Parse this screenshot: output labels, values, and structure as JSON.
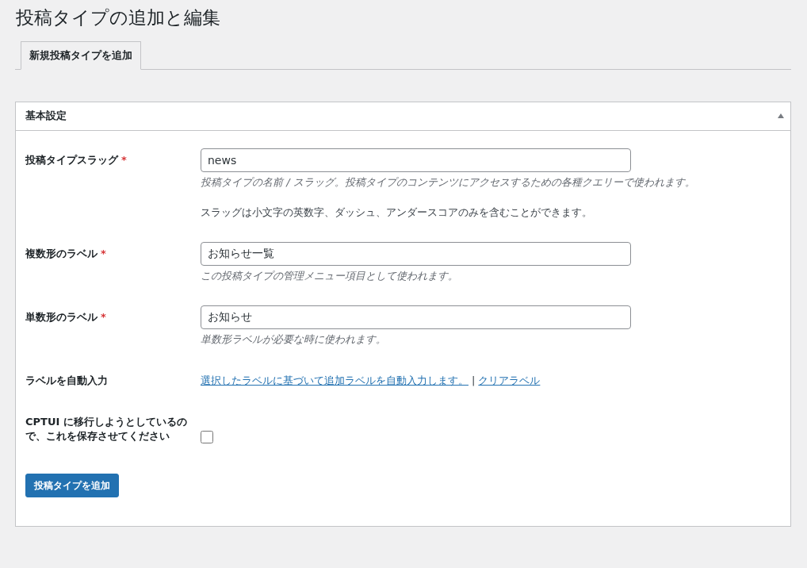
{
  "page_title": "投稿タイプの追加と編集",
  "tabs": [
    {
      "label": "新規投稿タイプを追加",
      "selected": true
    }
  ],
  "panel": {
    "title": "基本設定",
    "expanded": true,
    "rows": [
      {
        "kind": "text",
        "label": "投稿タイプスラッグ",
        "required_mark": "*",
        "value": "news",
        "description": "投稿タイプの名前 / スラッグ。投稿タイプのコンテンツにアクセスするための各種クエリーで使われます。",
        "note": "スラッグは小文字の英数字、ダッシュ、アンダースコアのみを含むことができます。"
      },
      {
        "kind": "text",
        "label": "複数形のラベル",
        "required_mark": "*",
        "value": "お知らせ一覧",
        "description": "この投稿タイプの管理メニュー項目として使われます。"
      },
      {
        "kind": "text",
        "label": "単数形のラベル",
        "required_mark": "*",
        "value": "お知らせ",
        "description": "単数形ラベルが必要な時に使われます。"
      },
      {
        "kind": "links",
        "label": "ラベルを自動入力",
        "links": [
          "選択したラベルに基づいて追加ラベルを自動入力します。",
          "クリアラベル"
        ],
        "separator": "|"
      },
      {
        "kind": "checkbox",
        "label": "CPTUI に移行しようとしているので、これを保存させてください",
        "checked": false
      }
    ],
    "submit": "投稿タイプを追加"
  }
}
